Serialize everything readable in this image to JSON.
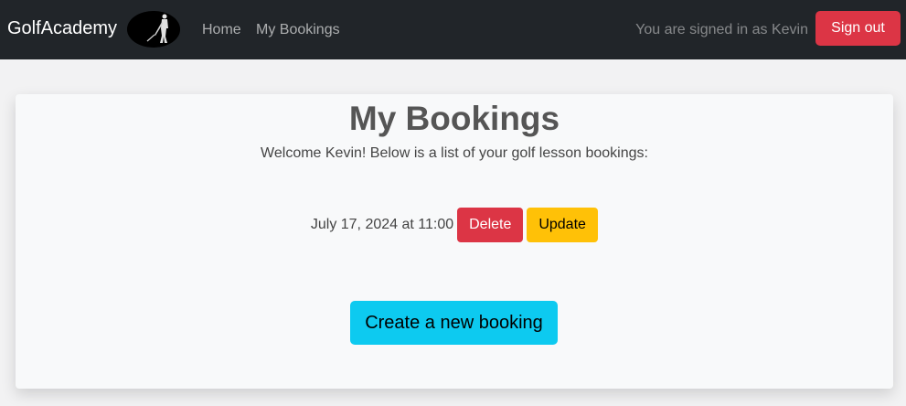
{
  "navbar": {
    "brand": "GolfAcademy",
    "links": [
      "Home",
      "My Bookings"
    ],
    "signed_in_text": "You are signed in as Kevin",
    "signout_label": "Sign out"
  },
  "page": {
    "title": "My Bookings",
    "welcome": "Welcome Kevin! Below is a list of your golf lesson bookings:"
  },
  "bookings": [
    {
      "datetime": "July 17, 2024 at 11:00",
      "delete_label": "Delete",
      "update_label": "Update"
    }
  ],
  "create_label": "Create a new booking",
  "colors": {
    "navbar": "#212529",
    "danger": "#dc3545",
    "warning": "#ffc107",
    "info": "#0dcaf0"
  }
}
